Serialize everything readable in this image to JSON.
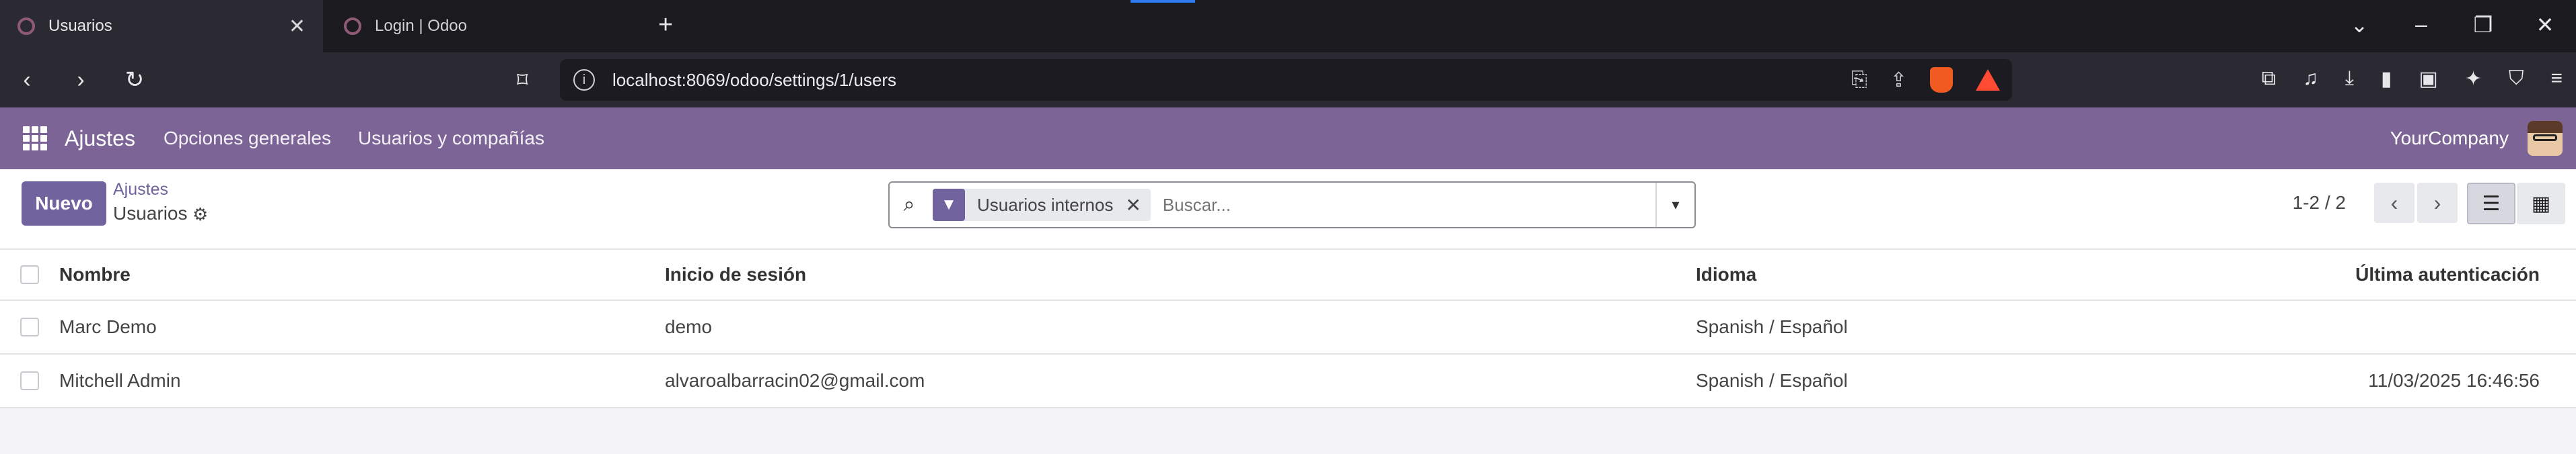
{
  "browser": {
    "tabs": [
      {
        "title": "Usuarios",
        "active": true
      },
      {
        "title": "Login | Odoo",
        "active": false
      }
    ],
    "url": "localhost:8069/odoo/settings/1/users"
  },
  "navbar": {
    "brand": "Ajustes",
    "menu": [
      "Opciones generales",
      "Usuarios y compañías"
    ],
    "company": "YourCompany"
  },
  "control_panel": {
    "new_button": "Nuevo",
    "breadcrumb_parent": "Ajustes",
    "breadcrumb_current": "Usuarios",
    "search_facet": "Usuarios internos",
    "search_placeholder": "Buscar...",
    "pager": "1-2 / 2"
  },
  "table": {
    "headers": [
      "Nombre",
      "Inicio de sesión",
      "Idioma",
      "Última autenticación"
    ],
    "rows": [
      {
        "name": "Marc Demo",
        "login": "demo",
        "language": "Spanish / Español",
        "last_auth": ""
      },
      {
        "name": "Mitchell Admin",
        "login": "alvaroalbarracin02@gmail.com",
        "language": "Spanish / Español",
        "last_auth": "11/03/2025 16:46:56"
      }
    ]
  },
  "colors": {
    "odoo_primary": "#71639e",
    "navbar": "#7c6596"
  }
}
